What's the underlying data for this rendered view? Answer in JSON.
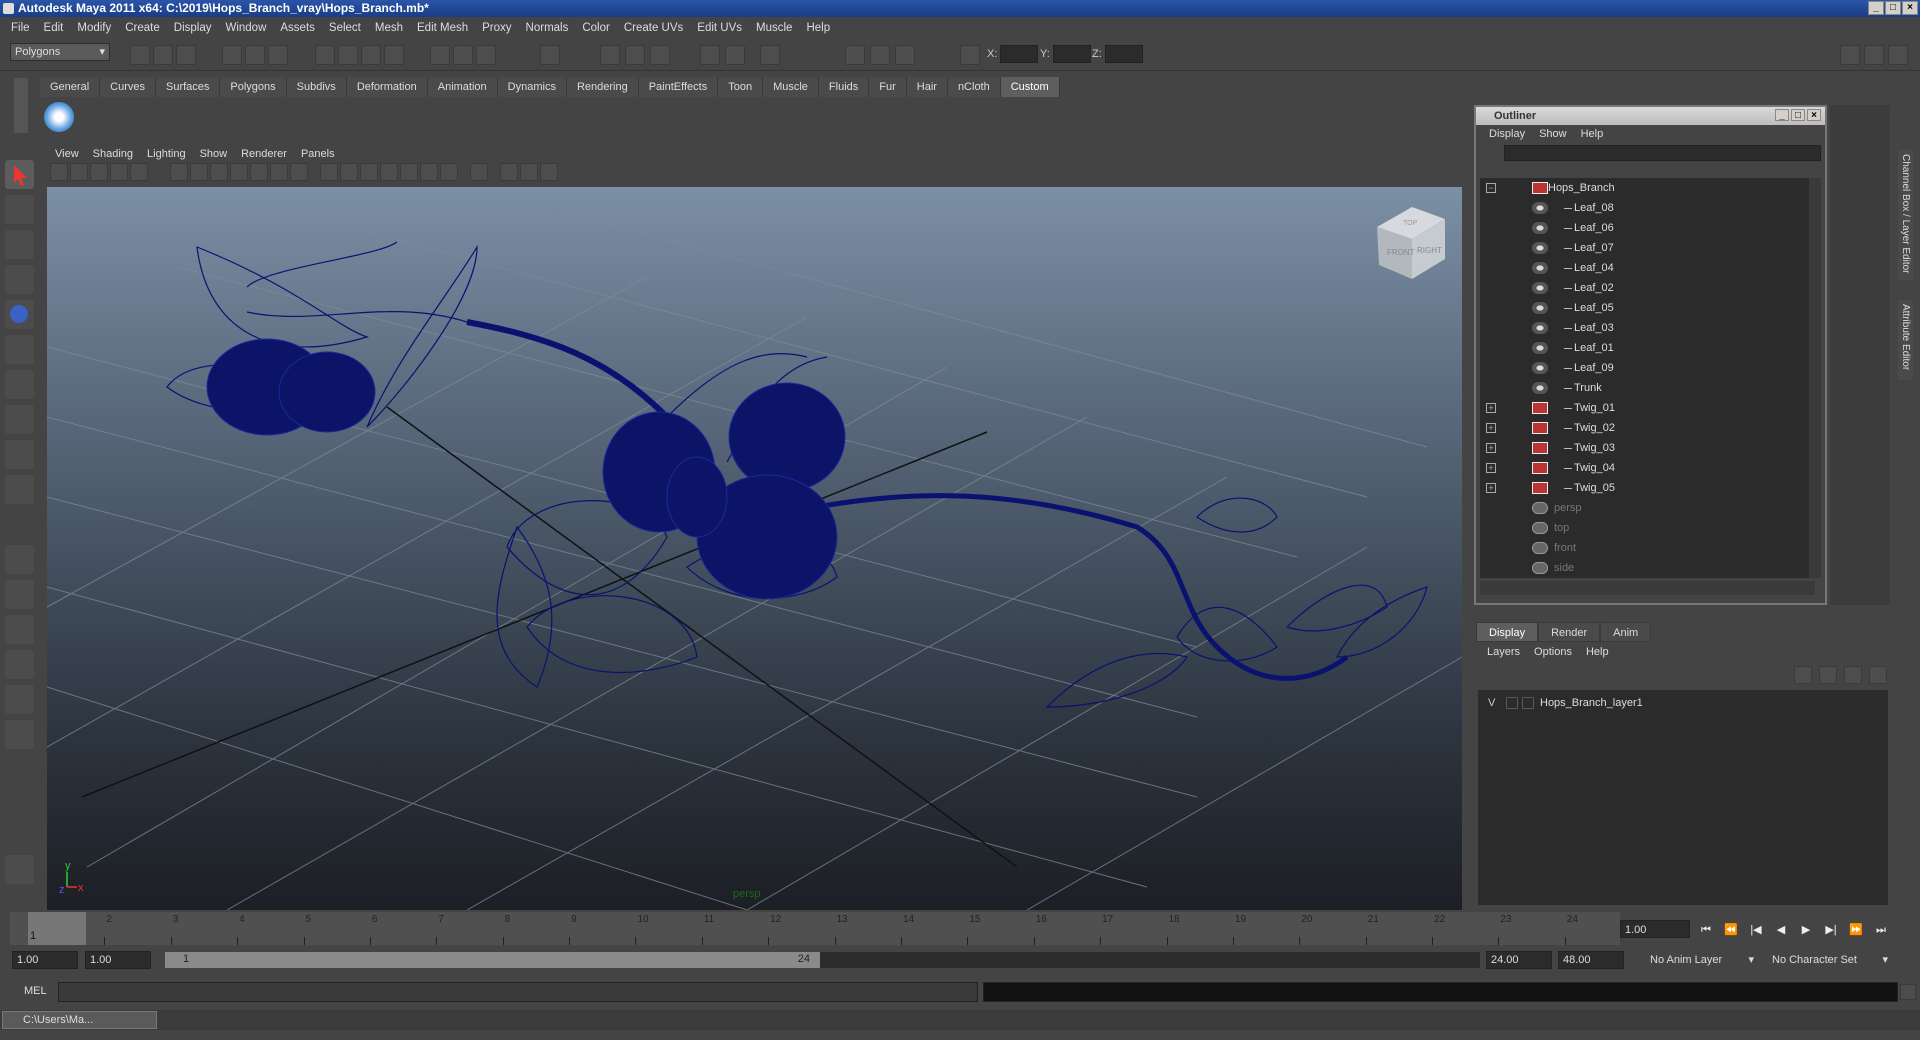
{
  "window": {
    "title": "Autodesk Maya 2011 x64: C:\\2019\\Hops_Branch_vray\\Hops_Branch.mb*"
  },
  "menu": [
    "File",
    "Edit",
    "Modify",
    "Create",
    "Display",
    "Window",
    "Assets",
    "Select",
    "Mesh",
    "Edit Mesh",
    "Proxy",
    "Normals",
    "Color",
    "Create UVs",
    "Edit UVs",
    "Muscle",
    "Help"
  ],
  "status": {
    "mode": "Polygons",
    "x_label": "X:",
    "y_label": "Y:",
    "z_label": "Z:"
  },
  "shelf_tabs": [
    "General",
    "Curves",
    "Surfaces",
    "Polygons",
    "Subdivs",
    "Deformation",
    "Animation",
    "Dynamics",
    "Rendering",
    "PaintEffects",
    "Toon",
    "Muscle",
    "Fluids",
    "Fur",
    "Hair",
    "nCloth",
    "Custom"
  ],
  "shelf_active": "Custom",
  "viewport": {
    "menu": [
      "View",
      "Shading",
      "Lighting",
      "Show",
      "Renderer",
      "Panels"
    ],
    "camera": "persp",
    "viewcube_front": "FRONT",
    "viewcube_right": "RIGHT",
    "viewcube_top": "TOP",
    "axis_x": "x",
    "axis_y": "y",
    "axis_z": "z"
  },
  "outliner": {
    "title": "Outliner",
    "menu": [
      "Display",
      "Show",
      "Help"
    ],
    "items": [
      {
        "label": "Hops_Branch",
        "type": "transform",
        "expand": "−",
        "depth": 0
      },
      {
        "label": "Leaf_08",
        "type": "mesh",
        "depth": 1
      },
      {
        "label": "Leaf_06",
        "type": "mesh",
        "depth": 1
      },
      {
        "label": "Leaf_07",
        "type": "mesh",
        "depth": 1
      },
      {
        "label": "Leaf_04",
        "type": "mesh",
        "depth": 1
      },
      {
        "label": "Leaf_02",
        "type": "mesh",
        "depth": 1
      },
      {
        "label": "Leaf_05",
        "type": "mesh",
        "depth": 1
      },
      {
        "label": "Leaf_03",
        "type": "mesh",
        "depth": 1
      },
      {
        "label": "Leaf_01",
        "type": "mesh",
        "depth": 1
      },
      {
        "label": "Leaf_09",
        "type": "mesh",
        "depth": 1
      },
      {
        "label": "Trunk",
        "type": "mesh",
        "depth": 1
      },
      {
        "label": "Twig_01",
        "type": "transform",
        "expand": "+",
        "depth": 1
      },
      {
        "label": "Twig_02",
        "type": "transform",
        "expand": "+",
        "depth": 1
      },
      {
        "label": "Twig_03",
        "type": "transform",
        "expand": "+",
        "depth": 1
      },
      {
        "label": "Twig_04",
        "type": "transform",
        "expand": "+",
        "depth": 1
      },
      {
        "label": "Twig_05",
        "type": "transform",
        "expand": "+",
        "depth": 1
      },
      {
        "label": "persp",
        "type": "camera",
        "depth": 0
      },
      {
        "label": "top",
        "type": "camera",
        "depth": 0
      },
      {
        "label": "front",
        "type": "camera",
        "depth": 0
      },
      {
        "label": "side",
        "type": "camera",
        "depth": 0
      }
    ]
  },
  "side_tabs": {
    "channel": "Channel Box / Layer Editor",
    "attribute": "Attribute Editor"
  },
  "layers": {
    "tabs": [
      "Display",
      "Render",
      "Anim"
    ],
    "active_tab": "Display",
    "menu": [
      "Layers",
      "Options",
      "Help"
    ],
    "items": [
      {
        "visible": "V",
        "name": "Hops_Branch_layer1"
      }
    ]
  },
  "timeline": {
    "ticks": [
      "1",
      "2",
      "3",
      "4",
      "5",
      "6",
      "7",
      "8",
      "9",
      "10",
      "11",
      "12",
      "13",
      "14",
      "15",
      "16",
      "17",
      "18",
      "19",
      "20",
      "21",
      "22",
      "23",
      "24"
    ],
    "current_marker": "1",
    "current_frame": "1.00"
  },
  "range": {
    "start": "1.00",
    "inner_start": "1.00",
    "slider_start": "1",
    "slider_end": "24",
    "end": "24.00",
    "outer_end": "48.00",
    "anim_layer": "No Anim Layer",
    "char_set": "No Character Set"
  },
  "mel": {
    "label": "MEL"
  },
  "taskbar": {
    "item": "C:\\Users\\Ma..."
  },
  "colors": {
    "wire": "#0a1270",
    "grid": "#7f8a96",
    "title_bg": "#1e4593"
  }
}
